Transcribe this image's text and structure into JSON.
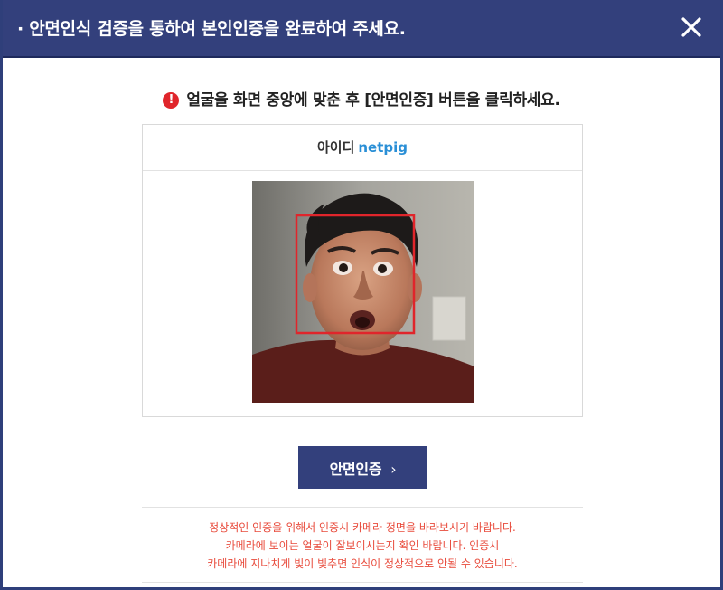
{
  "header": {
    "title": "· 안면인식 검증을 통하여 본인인증을 완료하여 주세요.",
    "close_icon": "close-icon"
  },
  "notice": {
    "icon": "alert-icon",
    "icon_glyph": "!",
    "text": "얼굴을 화면 중앙에 맞춘 후 [안면인증] 버튼을 클릭하세요."
  },
  "card": {
    "id_label": "아이디",
    "id_value": "netpig"
  },
  "button": {
    "label": "안면인증",
    "chevron": "›"
  },
  "warnings": [
    "정상적인 인증을 위해서 인증시 카메라 정면을 바라보시기 바랍니다.",
    "카메라에 보이는 얼굴이 잘보이시는지 확인 바랍니다. 인증시",
    "카메라에 지나치게 빛이 빛추면 인식이 정상적으로 안될 수 있습니다."
  ],
  "colors": {
    "primary": "#33407c",
    "accent_id": "#2a8fd6",
    "warning": "#e84b3c",
    "face_box": "#e0252b"
  }
}
